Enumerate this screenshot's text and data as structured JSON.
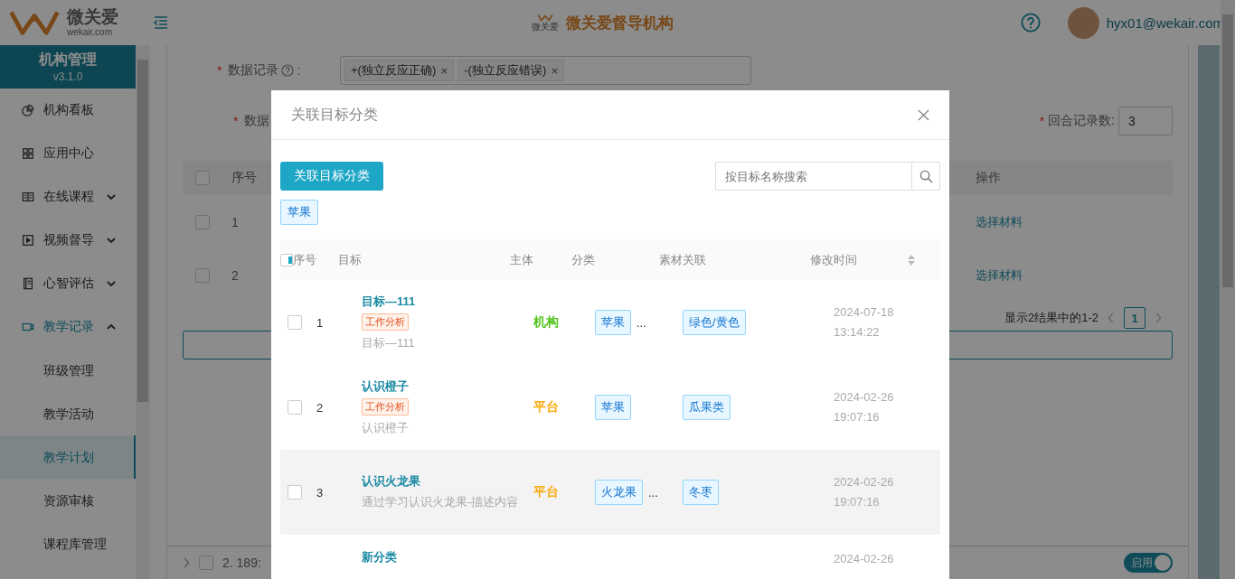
{
  "header": {
    "logo_name": "微关爱",
    "logo_domain": "wekair.com",
    "center_logo_mark": "微关爱",
    "center_title": "微关爱督导机构",
    "user": "hyx01@wekair.com"
  },
  "sidebar": {
    "title": "机构管理",
    "version": "v3.1.0",
    "items": [
      {
        "label": "机构看板",
        "kind": "link",
        "active": false
      },
      {
        "label": "应用中心",
        "kind": "link",
        "active": false
      },
      {
        "label": "在线课程",
        "kind": "group",
        "active": false,
        "expanded": false
      },
      {
        "label": "视频督导",
        "kind": "group",
        "active": false,
        "expanded": false
      },
      {
        "label": "心智评估",
        "kind": "group",
        "active": false,
        "expanded": false
      },
      {
        "label": "教学记录",
        "kind": "group",
        "active": true,
        "expanded": true,
        "children": [
          {
            "label": "班级管理",
            "selected": false
          },
          {
            "label": "教学活动",
            "selected": false
          },
          {
            "label": "教学计划",
            "selected": true
          },
          {
            "label": "资源审核",
            "selected": false
          },
          {
            "label": "课程库管理",
            "selected": false
          }
        ]
      }
    ]
  },
  "form": {
    "required_marks": [
      "*",
      "*",
      "*"
    ],
    "data_record_colon": ":",
    "data_record_label": "数据记录",
    "data_record_tags": [
      "+(独立反应正确)",
      "-(独立反应错误)"
    ],
    "second_label": "数据",
    "rounds_label": "回合记录数:",
    "rounds_value": "3"
  },
  "background_table": {
    "header_checked": false,
    "columns": [
      "序号",
      "操作"
    ],
    "rows": [
      {
        "index": "1",
        "checked": false,
        "action": "选择材料"
      },
      {
        "index": "2",
        "checked": false,
        "action": "选择材料"
      }
    ],
    "pagination_text": "显示2结果中的1-2",
    "pages": [
      {
        "label": "1",
        "selected": true
      }
    ]
  },
  "bottom_row": {
    "checked": false,
    "text": "2. 189:",
    "toggle_label": "启用",
    "toggle_on": true
  },
  "modal": {
    "title": "关联目标分类",
    "primary_button": "关联目标分类",
    "search_placeholder": "按目标名称搜索",
    "filter_tags": [
      "苹果"
    ],
    "columns": [
      "序号",
      "目标",
      "主体",
      "分类",
      "素材关联",
      "修改时间"
    ],
    "header_checkbox_indeterminate": true,
    "rows": [
      {
        "kind": "full",
        "index": "1",
        "checked": false,
        "highlighted": false,
        "title": "目标—111",
        "tag": "工作分析",
        "desc": "目标—111",
        "subject": "机构",
        "color": "#52c41a",
        "categories": [
          "苹果"
        ],
        "more": "...",
        "materials": [
          "绿色/黄色"
        ],
        "date": "2024-07-18",
        "time": "13:14:22"
      },
      {
        "kind": "full",
        "index": "2",
        "checked": false,
        "highlighted": false,
        "title": "认识橙子",
        "tag": "工作分析",
        "desc": "认识橙子",
        "subject": "平台",
        "color": "#faad14",
        "categories": [
          "苹果"
        ],
        "materials": [
          "瓜果类"
        ],
        "date": "2024-02-26",
        "time": "19:07:16"
      },
      {
        "kind": "full",
        "index": "3",
        "checked": false,
        "highlighted": true,
        "title": "认识火龙果",
        "desc": "通过学习认识火龙果-描述内容",
        "subject": "平台",
        "color": "#faad14",
        "categories": [
          "火龙果"
        ],
        "more": "...",
        "materials": [
          "冬枣"
        ],
        "date": "2024-02-26",
        "time": "19:07:16"
      },
      {
        "kind": "cut",
        "title": "新分类",
        "date": "2024-02-26"
      }
    ]
  }
}
